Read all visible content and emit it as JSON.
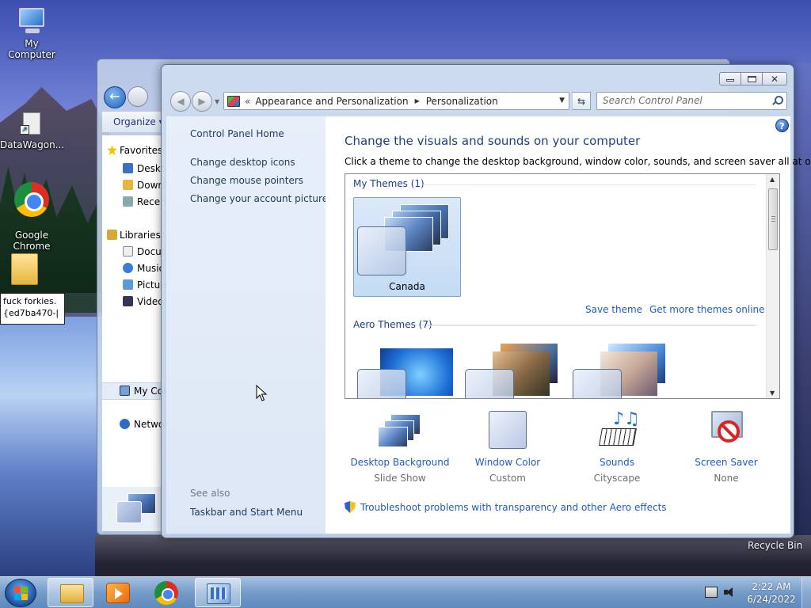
{
  "desktop": {
    "icons": [
      {
        "label": "My Computer"
      },
      {
        "label": "DataWagon..."
      },
      {
        "label": "Google\nChrome"
      },
      {
        "label": ""
      }
    ],
    "rename_text_line1": "fuck forkies.",
    "rename_text_line2": "{ed7ba470-|",
    "recycle_bin_label": "Recycle Bin"
  },
  "background_window": {
    "toolbar_label": "Organize",
    "sidebar_items": [
      {
        "label": "Favorites",
        "icon": "star-icon"
      },
      {
        "label": "Desktop",
        "icon": "desktop-icon"
      },
      {
        "label": "Downloads",
        "icon": "downloads-icon"
      },
      {
        "label": "Recent Places",
        "icon": "recent-icon"
      },
      {
        "label": "Libraries",
        "icon": "library-icon"
      },
      {
        "label": "Documents",
        "icon": "documents-icon"
      },
      {
        "label": "Music",
        "icon": "music-icon"
      },
      {
        "label": "Pictures",
        "icon": "pictures-icon"
      },
      {
        "label": "Videos",
        "icon": "videos-icon"
      },
      {
        "label": "My Computer",
        "icon": "computer-icon"
      },
      {
        "label": "Network",
        "icon": "network-icon"
      }
    ]
  },
  "window": {
    "breadcrumb": {
      "chevron": "«",
      "items": [
        "Appearance and Personalization",
        "Personalization"
      ]
    },
    "search_placeholder": "Search Control Panel",
    "left_pane": {
      "home_link": "Control Panel Home",
      "links": [
        "Change desktop icons",
        "Change mouse pointers",
        "Change your account picture"
      ],
      "see_also_label": "See also",
      "see_also_links": [
        "Taskbar and Start Menu"
      ]
    },
    "content": {
      "title": "Change the visuals and sounds on your computer",
      "subtitle": "Click a theme to change the desktop background, window color, sounds, and screen saver all at once.",
      "my_themes_label": "My Themes (1)",
      "selected_theme": "Canada",
      "save_theme_link": "Save theme",
      "more_themes_link": "Get more themes online",
      "aero_themes_label": "Aero Themes (7)",
      "bottom_items": [
        {
          "label": "Desktop Background",
          "value": "Slide Show",
          "icon": "desktop-background-icon"
        },
        {
          "label": "Window Color",
          "value": "Custom",
          "icon": "window-color-icon"
        },
        {
          "label": "Sounds",
          "value": "Cityscape",
          "icon": "sounds-icon"
        },
        {
          "label": "Screen Saver",
          "value": "None",
          "icon": "screen-saver-icon"
        }
      ],
      "troubleshoot_link": "Troubleshoot problems with transparency and other Aero effects"
    }
  },
  "taskbar": {
    "time": "2:22 AM",
    "date": "6/24/2022"
  }
}
